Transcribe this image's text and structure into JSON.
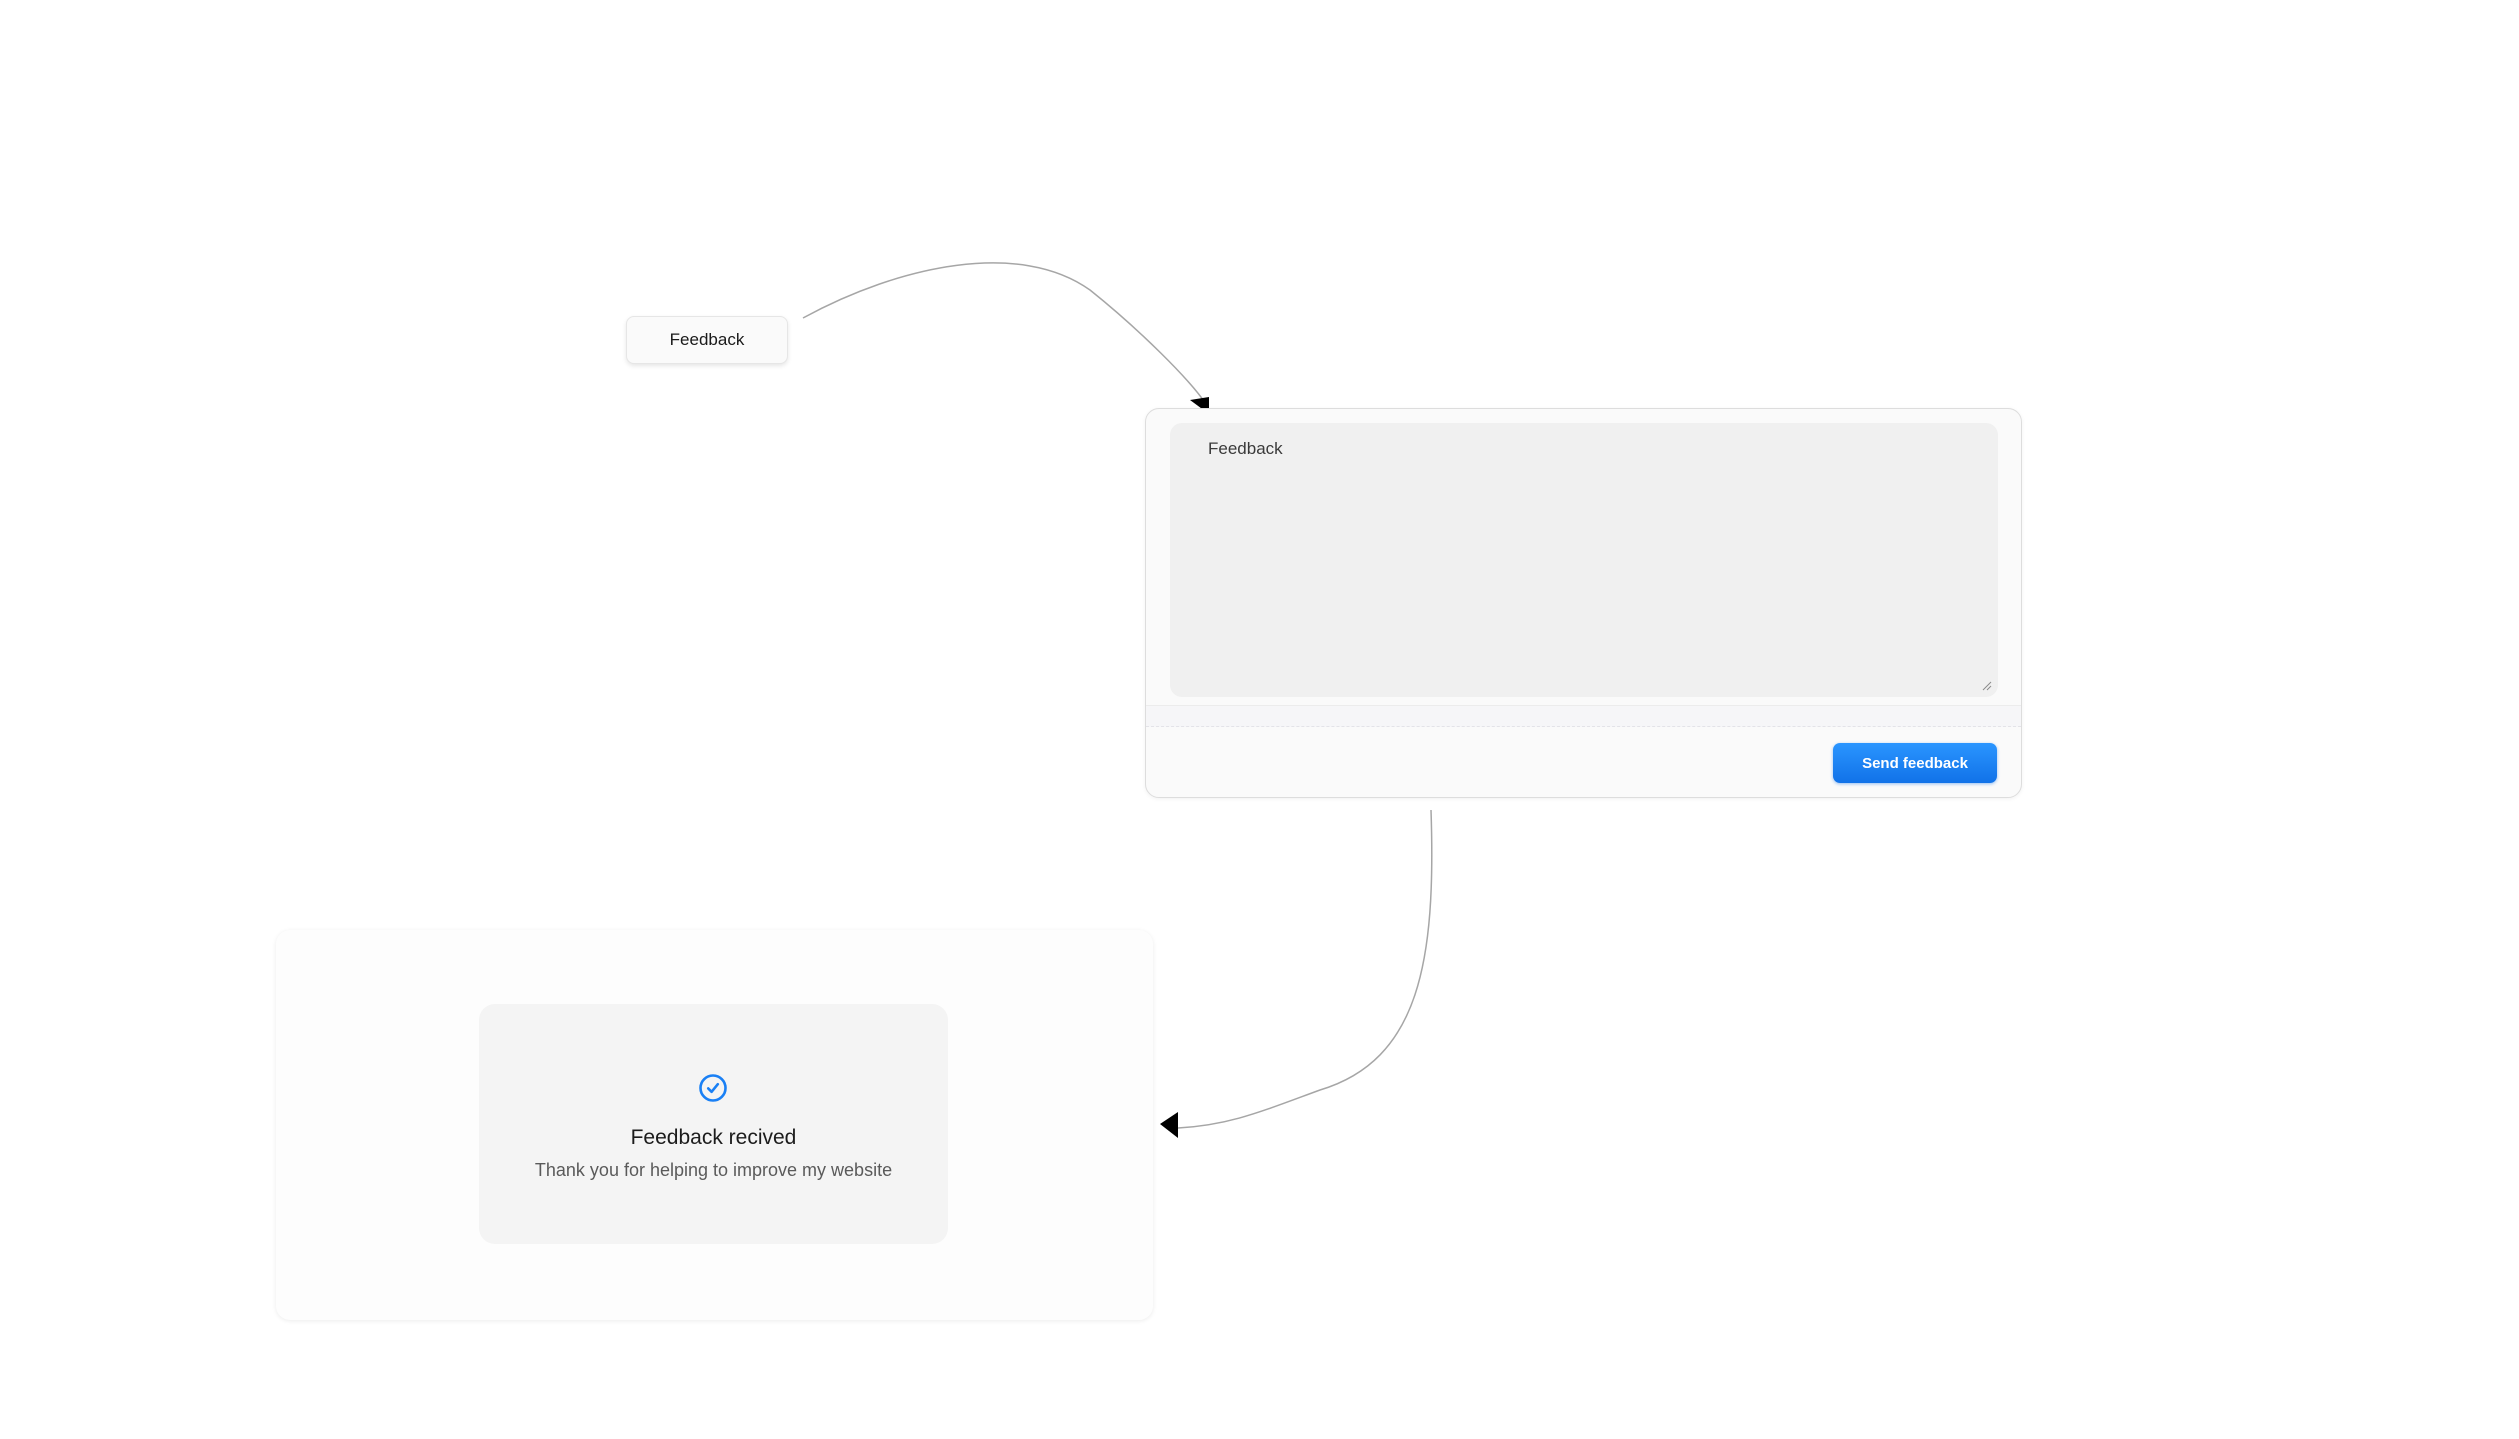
{
  "trigger": {
    "label": "Feedback"
  },
  "form": {
    "placeholder": "Feedback",
    "submit_label": "Send feedback"
  },
  "confirmation": {
    "icon": "check-circle-icon",
    "title": "Feedback recived",
    "message": "Thank you for helping to improve my website"
  },
  "colors": {
    "accent": "#1a80f5",
    "connector": "#a6a6a6",
    "arrowhead": "#000000"
  }
}
